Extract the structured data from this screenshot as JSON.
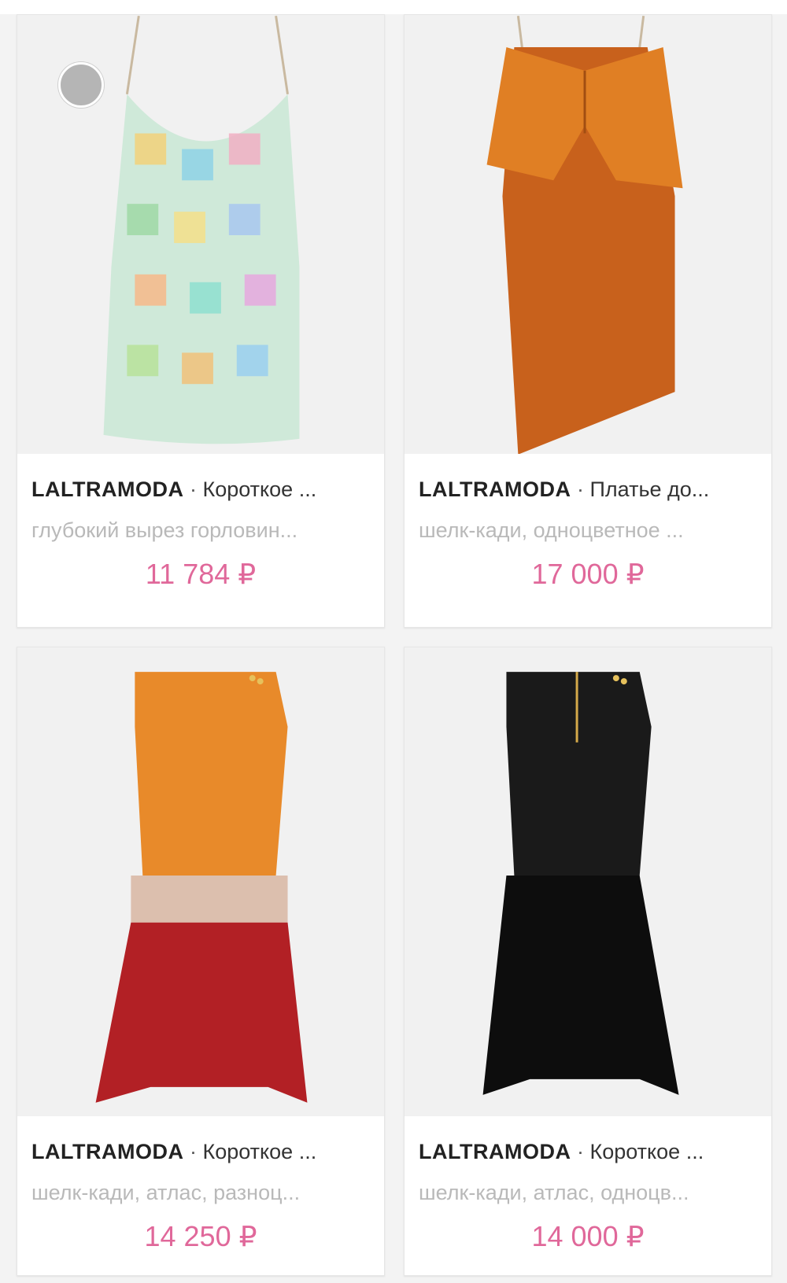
{
  "products": [
    {
      "brand": "LALTRAMODA",
      "separator": "·",
      "name": "Короткое ...",
      "description": "глубокий вырез горловин...",
      "price": "11 784 ₽",
      "image_icon": "dress-image"
    },
    {
      "brand": "LALTRAMODA",
      "separator": "·",
      "name": "Платье до...",
      "description": "шелк-кади, одноцветное ...",
      "price": "17 000 ₽",
      "image_icon": "dress-image"
    },
    {
      "brand": "LALTRAMODA",
      "separator": "·",
      "name": "Короткое ...",
      "description": "шелк-кади, атлас, разноц...",
      "price": "14 250 ₽",
      "image_icon": "dress-image"
    },
    {
      "brand": "LALTRAMODA",
      "separator": "·",
      "name": "Короткое ...",
      "description": "шелк-кади, атлас, одноцв...",
      "price": "14 000 ₽",
      "image_icon": "dress-image"
    }
  ],
  "colors": {
    "price": "#e0689a",
    "background": "#f3f3f3",
    "card": "#ffffff"
  }
}
